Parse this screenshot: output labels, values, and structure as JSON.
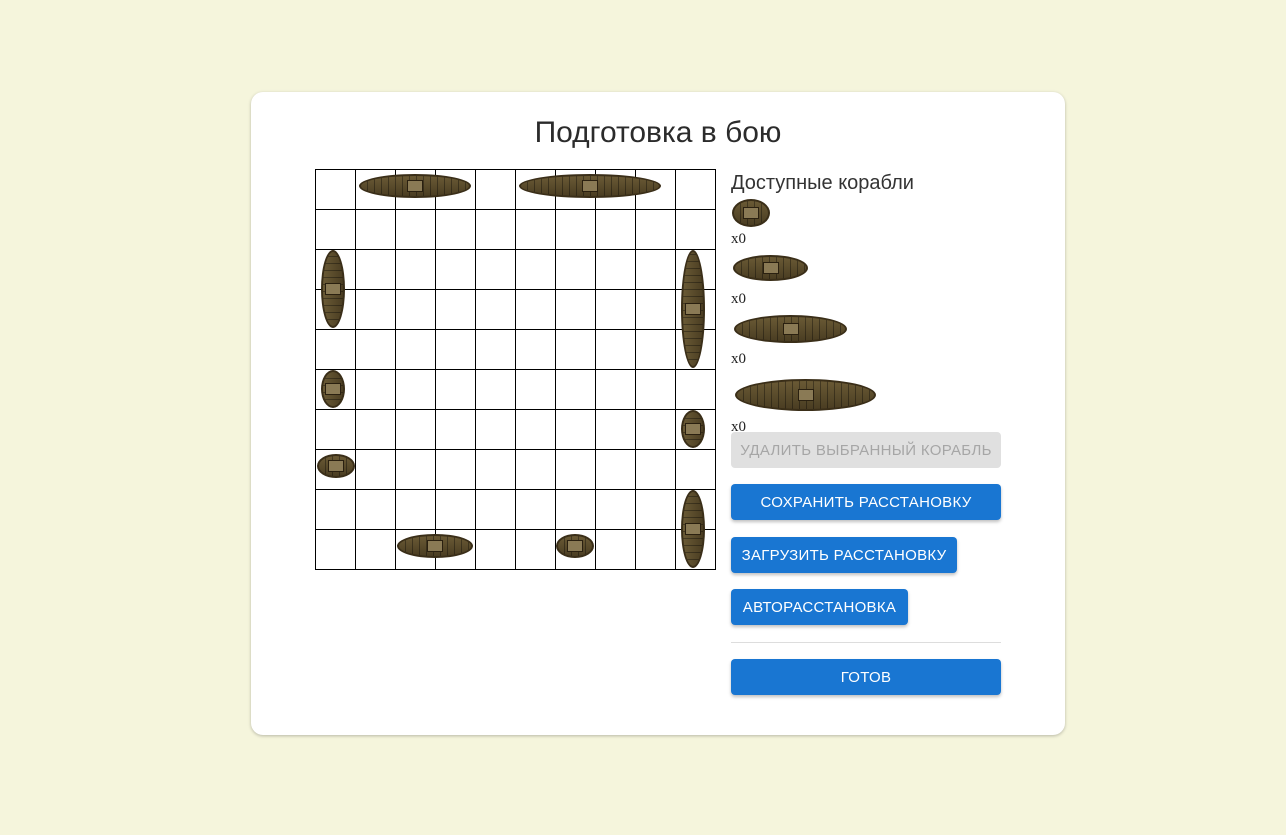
{
  "title": "Подготовка в бою",
  "panel": {
    "title": "Доступные корабли",
    "ships": [
      {
        "size": 1,
        "count": "x0"
      },
      {
        "size": 2,
        "count": "x0"
      },
      {
        "size": 3,
        "count": "x0"
      },
      {
        "size": 4,
        "count": "x0"
      }
    ]
  },
  "buttons": {
    "delete": "УДАЛИТЬ ВЫБРАННЫЙ КОРАБЛЬ",
    "save": "СОХРАНИТЬ РАССТАНОВКУ",
    "load": "ЗАГРУЗИТЬ РАССТАНОВКУ",
    "auto": "АВТОРАССТАНОВКА",
    "ready": "ГОТОВ"
  },
  "colors": {
    "background": "#f5f5dc",
    "primary": "#1976d2",
    "disabled": "#e0e0e0"
  }
}
